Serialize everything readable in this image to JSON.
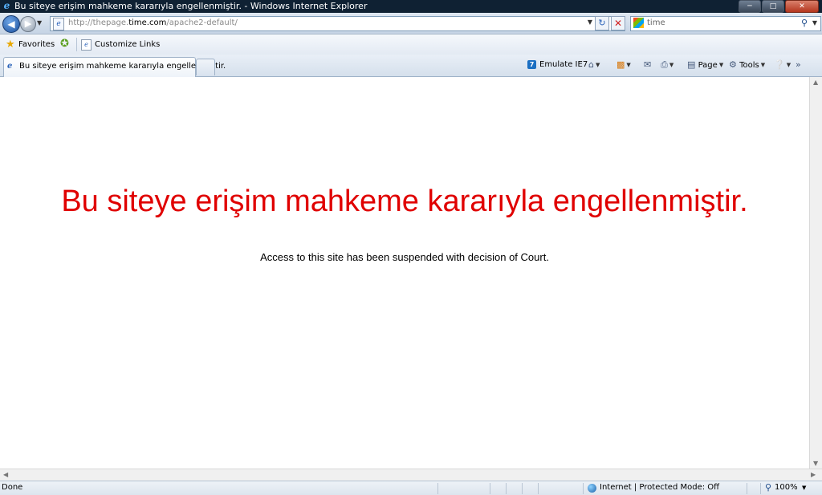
{
  "window": {
    "title": "Bu siteye erişim mahkeme kararıyla engellenmiştir. - Windows Internet Explorer"
  },
  "address_bar": {
    "url_prefix": "http://thepage.",
    "url_domain": "time.com",
    "url_path": "/apache2-default/"
  },
  "search": {
    "value": "time"
  },
  "favorites_bar": {
    "favorites_label": "Favorites",
    "customize_links_label": "Customize Links"
  },
  "tab": {
    "label": "Bu siteye erişim mahkeme kararıyla engellenmiştir."
  },
  "command_bar": {
    "emulate_label": "Emulate IE7",
    "page_label": "Page",
    "tools_label": "Tools"
  },
  "page": {
    "heading": "Bu siteye erişim mahkeme kararıyla engellenmiştir.",
    "subtext": "Access to this site has been suspended with decision of Court.",
    "heading_color": "#e00000"
  },
  "status_bar": {
    "status": "Done",
    "zone": "Internet | Protected Mode: Off",
    "zoom": "100%"
  }
}
